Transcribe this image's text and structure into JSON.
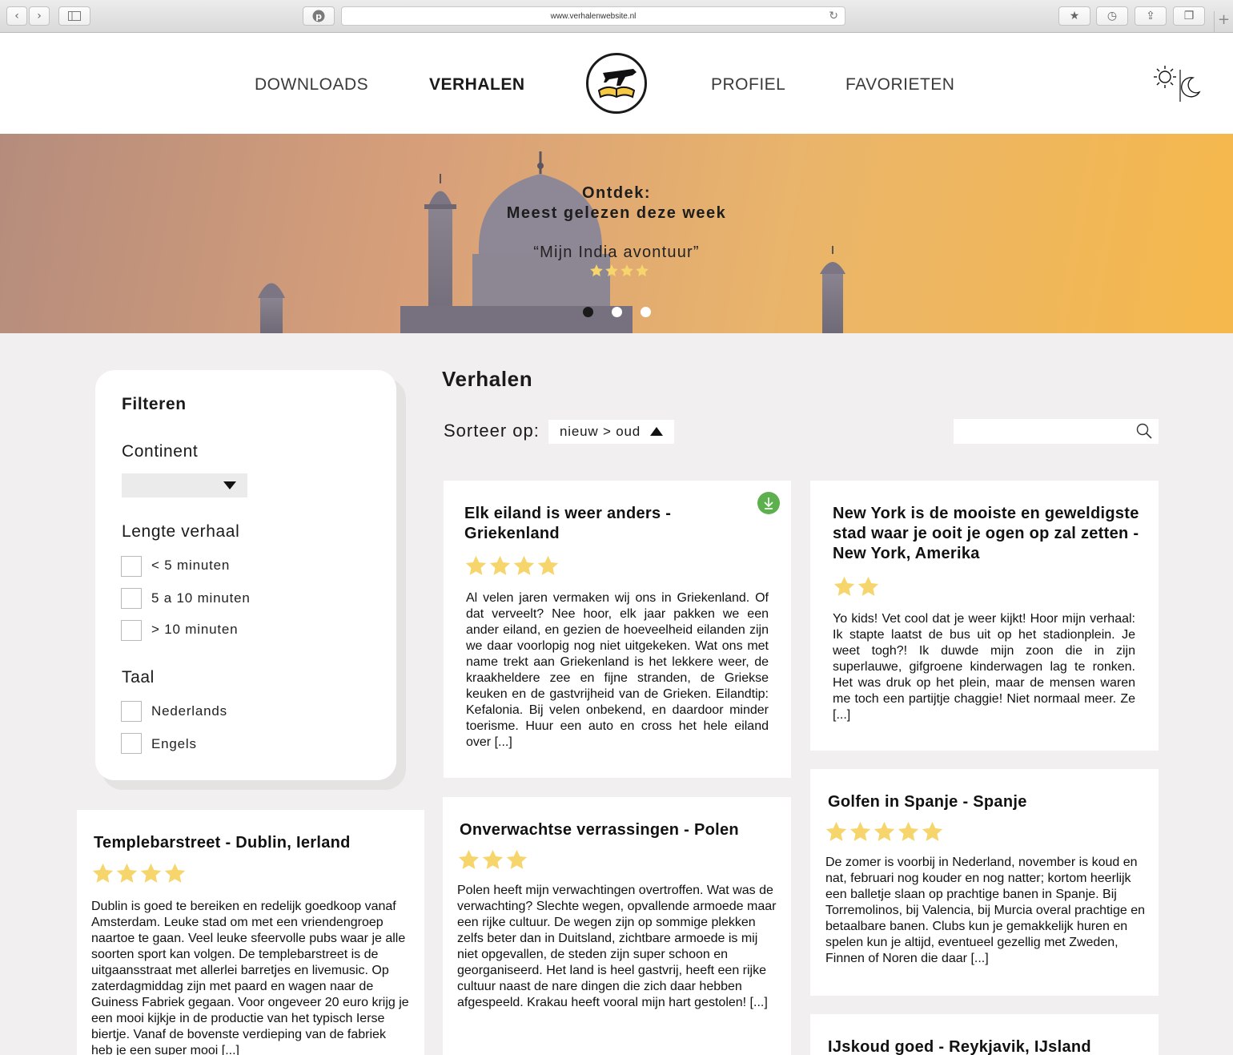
{
  "browser": {
    "url": "www.verhalenwebsite.nl"
  },
  "nav": {
    "items": [
      "DOWNLOADS",
      "VERHALEN",
      "PROFIEL",
      "FAVORIETEN"
    ],
    "active": "VERHALEN"
  },
  "hero": {
    "line1": "Ontdek:",
    "line2": "Meest gelezen deze week",
    "quote": "“Mijn India avontuur”",
    "rating": 4,
    "slides": 3,
    "active_slide": 1
  },
  "filter": {
    "title": "Filteren",
    "continent_label": "Continent",
    "continent_value": "",
    "length_label": "Lengte verhaal",
    "length_options": [
      "< 5 minuten",
      "5 a 10 minuten",
      "> 10 minuten"
    ],
    "language_label": "Taal",
    "language_options": [
      "Nederlands",
      "Engels"
    ]
  },
  "main": {
    "title": "Verhalen",
    "sort_label": "Sorteer op:",
    "sort_value": "nieuw > oud",
    "search_placeholder": ""
  },
  "stories": [
    {
      "title": "Elk eiland is weer anders - Griekenland",
      "rating": 4,
      "downloaded": true,
      "text": "Al velen jaren vermaken wij ons in Griekenland. Of dat verveelt? Nee hoor, elk jaar pakken we een ander eiland, en gezien de hoeveelheid eilanden zijn we daar voorlopig nog niet uitgekeken. Wat ons met name trekt aan Griekenland is het lekkere weer, de kraakheldere zee en fijne stranden, de Griekse keuken en de gastvrijheid van de Grieken. Eilandtip: Kefalonia. Bij velen onbekend, en daardoor minder toerisme. Huur een auto en cross het hele eiland over [...]"
    },
    {
      "title": "New York is de mooiste en geweldigste stad waar je ooit je ogen op zal zetten - New York, Amerika",
      "rating": 2,
      "downloaded": false,
      "text": "Yo kids! Vet cool dat je weer kijkt! Hoor mijn verhaal: Ik stapte laatst de bus uit op het stadionplein. Je weet togh?! Ik duwde mijn zoon die in zijn superlauwe, gifgroene kinderwagen lag te ronken. Het was druk op het plein, maar de mensen waren me toch een partijtje chaggie! Niet normaal meer. Ze [...]"
    },
    {
      "title": "Templebarstreet - Dublin, Ierland",
      "rating": 4,
      "downloaded": false,
      "text": "Dublin is goed te bereiken en redelijk goedkoop vanaf Amsterdam. Leuke stad om met een vriendengroep naartoe te gaan. Veel leuke sfeervolle pubs waar je alle soorten sport kan volgen. De templebarstreet is de uitgaansstraat met allerlei barretjes en livemusic. Op zaterdagmiddag zijn met paard en wagen naar de Guiness Fabriek gegaan. Voor ongeveer 20 euro krijg je een mooi kijkje in de productie van het typisch Ierse biertje. Vanaf de bovenste verdieping van de fabriek heb je een super mooi [...]"
    },
    {
      "title": "Onverwachtse verrassingen - Polen",
      "rating": 3,
      "downloaded": false,
      "text": "Polen heeft mijn verwachtingen overtroffen. Wat was de verwachting? Slechte wegen, opvallende armoede maar een rijke cultuur. De wegen zijn op sommige plekken zelfs beter dan in Duitsland, zichtbare armoede is mij niet opgevallen, de steden zijn super schoon en georganiseerd. Het land is heel gastvrij, heeft een rijke cultuur naast de nare dingen die zich daar hebben afgespeeld. Krakau heeft vooral mijn hart gestolen! [...]"
    },
    {
      "title": "Golfen in Spanje - Spanje",
      "rating": 5,
      "downloaded": false,
      "text": "De zomer is voorbij in Nederland, november is koud en nat, februari nog kouder en nog natter; kortom heerlijk een balletje slaan op prachtige banen in Spanje. Bij Torremolinos, bij Valencia, bij Murcia overal prachtige en betaalbare banen. Clubs kun je gemakkelijk huren en spelen kun je altijd, eventueel gezellig met Zweden, Finnen of Noren die daar [...]"
    },
    {
      "title": "IJskoud goed - Reykjavik, IJsland",
      "rating": 0,
      "downloaded": false,
      "text": ""
    }
  ],
  "colors": {
    "star": "#f6d66c",
    "download": "#5db04e",
    "page_bg": "#f1efef"
  },
  "icons": {
    "logo": "book-plane-logo",
    "theme_light": "sun-icon",
    "theme_dark": "moon-icon",
    "search": "search-icon",
    "download": "download-icon"
  }
}
